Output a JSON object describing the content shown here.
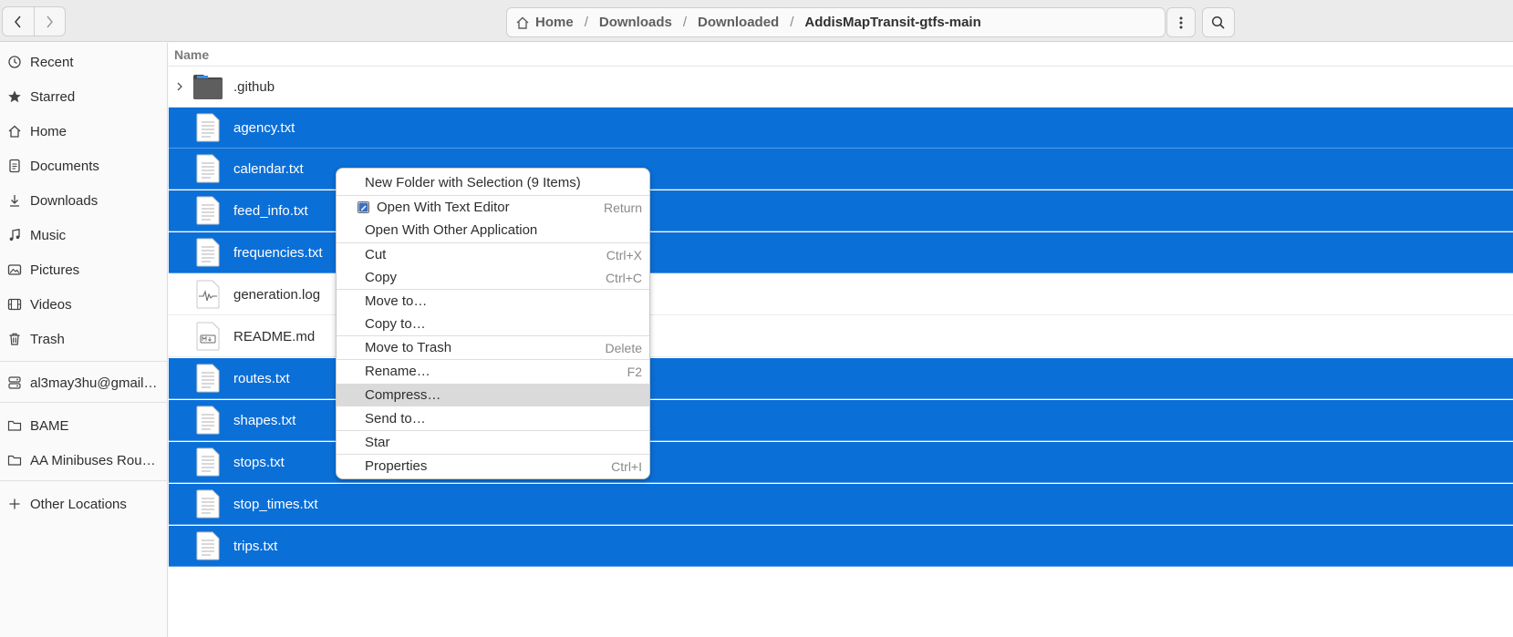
{
  "header": {
    "back_icon": "chevron-left-icon",
    "forward_icon": "chevron-right-icon",
    "breadcrumbs": [
      "Home",
      "Downloads",
      "Downloaded",
      "AddisMapTransit-gtfs-main"
    ],
    "separator": "/",
    "menu_icon": "vertical-dots-icon",
    "search_icon": "search-icon"
  },
  "sidebar": {
    "items": [
      {
        "label": "Recent",
        "icon": "clock-icon"
      },
      {
        "label": "Starred",
        "icon": "star-icon"
      },
      {
        "label": "Home",
        "icon": "home-icon"
      },
      {
        "label": "Documents",
        "icon": "document-icon"
      },
      {
        "label": "Downloads",
        "icon": "download-icon"
      },
      {
        "label": "Music",
        "icon": "music-icon"
      },
      {
        "label": "Pictures",
        "icon": "pictures-icon"
      },
      {
        "label": "Videos",
        "icon": "video-icon"
      },
      {
        "label": "Trash",
        "icon": "trash-icon"
      },
      {
        "label": "al3may3hu@gmail.com",
        "icon": "network-drive-icon"
      },
      {
        "label": "BAME",
        "icon": "folder-icon"
      },
      {
        "label": "AA Minibuses Routes",
        "icon": "folder-icon"
      },
      {
        "label": "Other Locations",
        "icon": "plus-icon"
      }
    ]
  },
  "list": {
    "column_header": "Name",
    "rows": [
      {
        "name": ".github",
        "type": "folder",
        "selected": false
      },
      {
        "name": "agency.txt",
        "type": "text",
        "selected": true
      },
      {
        "name": "calendar.txt",
        "type": "text",
        "selected": true
      },
      {
        "name": "feed_info.txt",
        "type": "text",
        "selected": true
      },
      {
        "name": "frequencies.txt",
        "type": "text",
        "selected": true
      },
      {
        "name": "generation.log",
        "type": "log",
        "selected": false
      },
      {
        "name": "README.md",
        "type": "markdown",
        "selected": false
      },
      {
        "name": "routes.txt",
        "type": "text",
        "selected": true
      },
      {
        "name": "shapes.txt",
        "type": "text",
        "selected": true
      },
      {
        "name": "stops.txt",
        "type": "text",
        "selected": true
      },
      {
        "name": "stop_times.txt",
        "type": "text",
        "selected": true
      },
      {
        "name": "trips.txt",
        "type": "text",
        "selected": true
      }
    ]
  },
  "context_menu": {
    "new_folder": "New Folder with Selection (9 Items)",
    "open_text_editor": "Open With Text Editor",
    "open_text_editor_accel": "Return",
    "open_other": "Open With Other Application",
    "cut": "Cut",
    "cut_accel": "Ctrl+X",
    "copy": "Copy",
    "copy_accel": "Ctrl+C",
    "move_to": "Move to…",
    "copy_to": "Copy to…",
    "move_to_trash": "Move to Trash",
    "move_to_trash_accel": "Delete",
    "rename": "Rename…",
    "rename_accel": "F2",
    "compress": "Compress…",
    "send_to": "Send to…",
    "star": "Star",
    "properties": "Properties",
    "properties_accel": "Ctrl+I"
  },
  "colors": {
    "selection": "#0b6fd8",
    "menu_hover": "#dadada"
  }
}
